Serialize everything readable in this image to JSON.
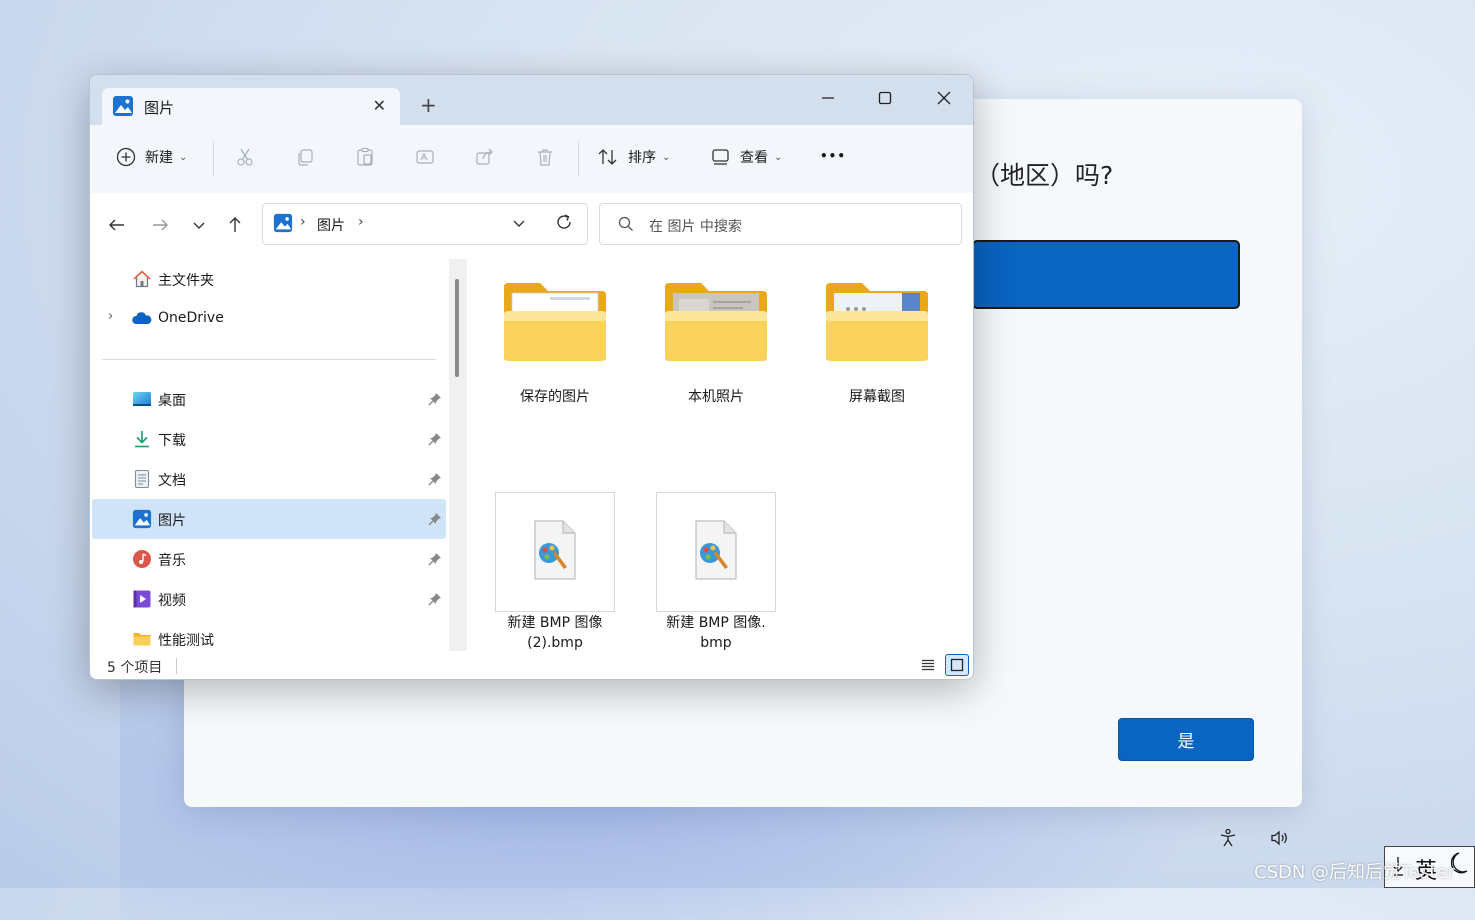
{
  "oobe": {
    "question": "（地区）吗?",
    "yes_label": "是"
  },
  "window": {
    "tab_title": "图片",
    "new_tab": "+"
  },
  "toolbar": {
    "new_label": "新建",
    "sort_label": "排序",
    "view_label": "查看",
    "more_label": "•••"
  },
  "address": {
    "path": "图片",
    "search_placeholder": "在 图片 中搜索"
  },
  "sidebar": {
    "items": [
      {
        "label": "主文件夹",
        "icon": "home-icon"
      },
      {
        "label": "OneDrive",
        "icon": "onedrive-cloud-icon"
      },
      {
        "label": "桌面",
        "icon": "desktop-icon"
      },
      {
        "label": "下载",
        "icon": "download-icon"
      },
      {
        "label": "文档",
        "icon": "document-icon"
      },
      {
        "label": "图片",
        "icon": "pictures-icon",
        "selected": true
      },
      {
        "label": "音乐",
        "icon": "music-icon"
      },
      {
        "label": "视频",
        "icon": "video-icon"
      },
      {
        "label": "性能测试",
        "icon": "folder-icon"
      }
    ]
  },
  "files": [
    {
      "name": "保存的图片",
      "type": "folder"
    },
    {
      "name": "本机照片",
      "type": "folder"
    },
    {
      "name": "屏幕截图",
      "type": "folder"
    },
    {
      "name_line1": "新建 BMP 图像",
      "name_line2": "(2).bmp",
      "type": "bmp"
    },
    {
      "name_line1": "新建 BMP 图像.",
      "name_line2": "bmp",
      "type": "bmp"
    }
  ],
  "status": {
    "item_count": "5 个项目"
  },
  "taskbar": {
    "ime_char": "英",
    "watermark": "CSDN @后知后觉Tester"
  },
  "colors": {
    "accent": "#0a64c2",
    "selection": "#cfe4f8",
    "folder": "#f6c544"
  }
}
